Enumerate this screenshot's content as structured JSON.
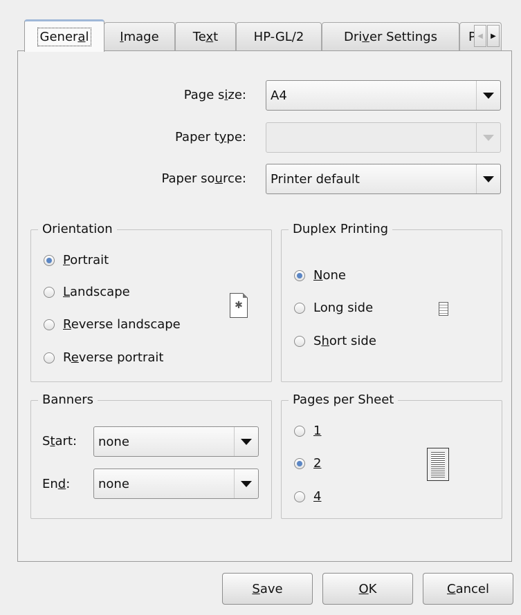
{
  "tabs": [
    {
      "pre": "Gener",
      "mn": "a",
      "post": "l",
      "active": true
    },
    {
      "pre": "",
      "mn": "I",
      "post": "mage"
    },
    {
      "pre": "Te",
      "mn": "x",
      "post": "t"
    },
    {
      "pre": "HP-GL/2",
      "mn": "",
      "post": ""
    },
    {
      "pre": "Dri",
      "mn": "v",
      "post": "er Settings"
    },
    {
      "pre": "P",
      "mn": "",
      "post": ""
    }
  ],
  "page_size": {
    "label_pre": "Page s",
    "label_mn": "i",
    "label_post": "ze:",
    "value": "A4"
  },
  "paper_type": {
    "label_pre": "Paper t",
    "label_mn": "y",
    "label_post": "pe:",
    "value": ""
  },
  "paper_source": {
    "label_pre": "Paper so",
    "label_mn": "u",
    "label_post": "rce:",
    "value": "Printer default"
  },
  "orientation": {
    "title": "Orientation",
    "options": [
      {
        "pre": "",
        "mn": "P",
        "post": "ortrait",
        "selected": true
      },
      {
        "pre": "",
        "mn": "L",
        "post": "andscape",
        "selected": false
      },
      {
        "pre": "",
        "mn": "R",
        "post": "everse landscape",
        "selected": false
      },
      {
        "pre": "R",
        "mn": "e",
        "post": "verse portrait",
        "selected": false
      }
    ]
  },
  "duplex": {
    "title": "Duplex Printing",
    "options": [
      {
        "pre": "",
        "mn": "N",
        "post": "one",
        "selected": true
      },
      {
        "pre": "Lon",
        "mn": "g",
        "post": " side",
        "selected": false
      },
      {
        "pre": "S",
        "mn": "h",
        "post": "ort side",
        "selected": false
      }
    ]
  },
  "banners": {
    "title": "Banners",
    "start": {
      "pre": "S",
      "mn": "t",
      "post": "art:",
      "value": "none"
    },
    "end": {
      "pre": "En",
      "mn": "d",
      "post": ":",
      "value": "none"
    }
  },
  "pages_per_sheet": {
    "title": "Pages per Sheet",
    "options": [
      {
        "pre": "",
        "mn": "1",
        "post": "",
        "selected": false
      },
      {
        "pre": "",
        "mn": "2",
        "post": "",
        "selected": true
      },
      {
        "pre": "",
        "mn": "4",
        "post": "",
        "selected": false
      }
    ]
  },
  "buttons": {
    "save": {
      "pre": "",
      "mn": "S",
      "post": "ave"
    },
    "ok": {
      "pre": "",
      "mn": "O",
      "post": "K"
    },
    "cancel": {
      "pre": "",
      "mn": "C",
      "post": "ancel"
    }
  },
  "colors": {
    "accent": "#5b86c4",
    "tab_highlight": "#9fb8d8"
  },
  "icons": {
    "tab_scroll_left": "chevron-left-icon",
    "tab_scroll_right": "chevron-right-icon",
    "orientation_preview": "portrait-page-icon",
    "duplex_preview": "single-page-icon",
    "pages_preview": "pages-per-sheet-icon"
  }
}
